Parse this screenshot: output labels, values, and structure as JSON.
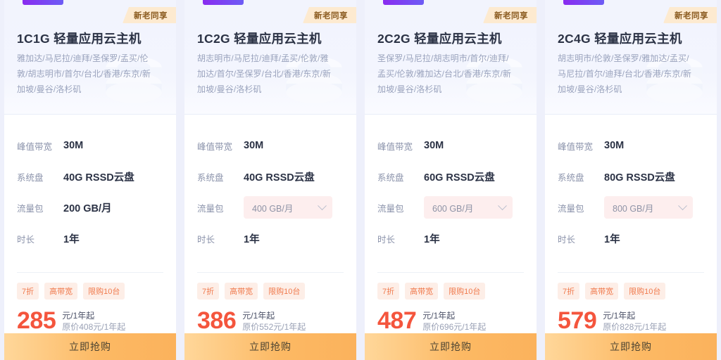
{
  "badges": {
    "share_label": "新老同享"
  },
  "buy_label": "立即抢购",
  "labels": {
    "bandwidth": "峰值带宽",
    "disk": "系统盘",
    "traffic": "流量包",
    "duration": "时长"
  },
  "colors": {
    "accent_purple": "#8a2bf0",
    "badge_bg": "#fdead0",
    "badge_text": "#8a5a1e",
    "price_red": "#f4553d",
    "tag_bg": "#fdeee7",
    "tag_text": "#f07a4d",
    "button_orange": "#fcb964",
    "page_bg": "#eef0fb"
  },
  "cards": [
    {
      "title": "1C1G 轻量应用云主机",
      "regions": "雅加达/马尼拉/迪拜/圣保罗/孟买/伦敦/胡志明市/首尔/台北/香港/东京/新加坡/曼谷/洛杉矶",
      "bandwidth": "30M",
      "disk": "40G RSSD云盘",
      "traffic": "200 GB/月",
      "traffic_is_select": false,
      "duration": "1年",
      "tags": [
        "7折",
        "高带宽",
        "限购10台"
      ],
      "price": "285",
      "price_unit": "元/1年起",
      "original": "原价408元/1年起"
    },
    {
      "title": "1C2G 轻量应用云主机",
      "regions": "胡志明市/马尼拉/迪拜/孟买/伦敦/雅加达/首尔/圣保罗/台北/香港/东京/新加坡/曼谷/洛杉矶",
      "bandwidth": "30M",
      "disk": "40G RSSD云盘",
      "traffic": "400 GB/月",
      "traffic_is_select": true,
      "duration": "1年",
      "tags": [
        "7折",
        "高带宽",
        "限购10台"
      ],
      "price": "386",
      "price_unit": "元/1年起",
      "original": "原价552元/1年起"
    },
    {
      "title": "2C2G 轻量应用云主机",
      "regions": "圣保罗/马尼拉/胡志明市/首尔/迪拜/孟买/伦敦/雅加达/台北/香港/东京/新加坡/曼谷/洛杉矶",
      "bandwidth": "30M",
      "disk": "60G RSSD云盘",
      "traffic": "600 GB/月",
      "traffic_is_select": true,
      "duration": "1年",
      "tags": [
        "7折",
        "高带宽",
        "限购10台"
      ],
      "price": "487",
      "price_unit": "元/1年起",
      "original": "原价696元/1年起"
    },
    {
      "title": "2C4G 轻量应用云主机",
      "regions": "胡志明市/伦敦/圣保罗/雅加达/孟买/马尼拉/首尔/迪拜/台北/香港/东京/新加坡/曼谷/洛杉矶",
      "bandwidth": "30M",
      "disk": "80G RSSD云盘",
      "traffic": "800 GB/月",
      "traffic_is_select": true,
      "duration": "1年",
      "tags": [
        "7折",
        "高带宽",
        "限购10台"
      ],
      "price": "579",
      "price_unit": "元/1年起",
      "original": "原价828元/1年起"
    }
  ]
}
